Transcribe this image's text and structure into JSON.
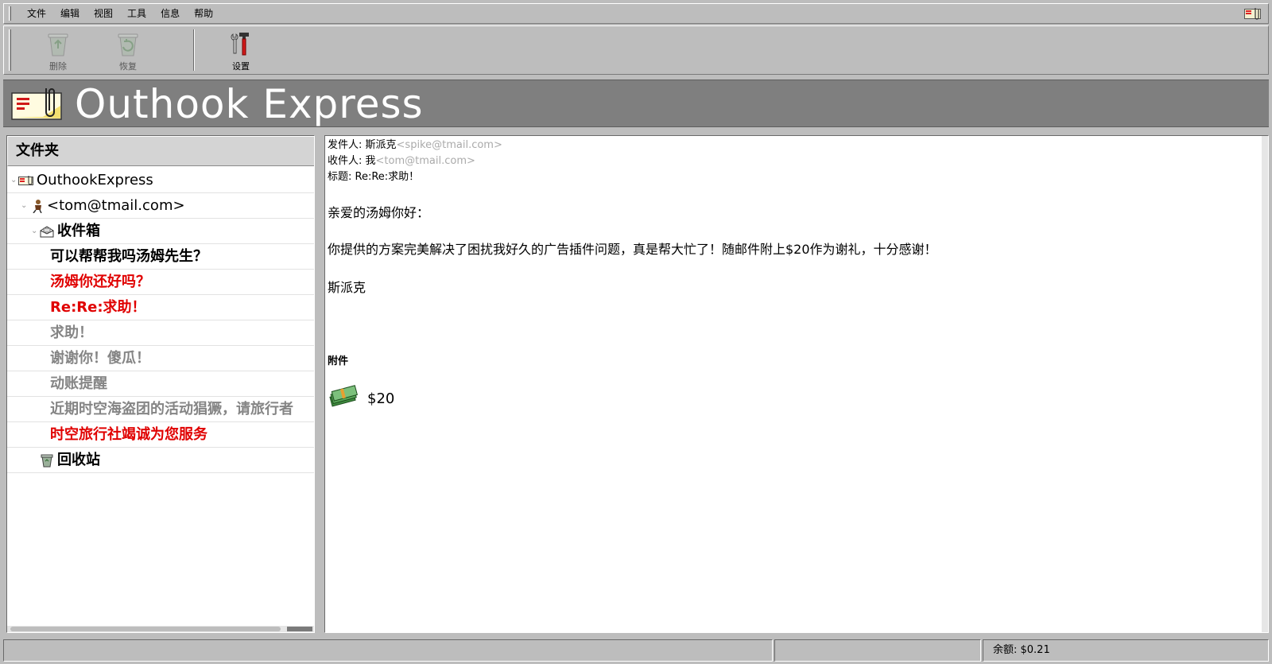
{
  "menubar": {
    "items": [
      "文件",
      "编辑",
      "视图",
      "工具",
      "信息",
      "帮助"
    ]
  },
  "toolbar": {
    "delete_label": "删除",
    "restore_label": "恢复",
    "settings_label": "设置"
  },
  "banner": {
    "title": "Outhook Express"
  },
  "folders": {
    "header": "文件夹",
    "root": "OuthookExpress",
    "account": "<tom@tmail.com>",
    "inbox": "收件箱",
    "messages": [
      {
        "subject": "可以帮帮我吗汤姆先生？",
        "state": "unread"
      },
      {
        "subject": "汤姆你还好吗？",
        "state": "unread-red"
      },
      {
        "subject": "Re:Re:求助！",
        "state": "unread-red"
      },
      {
        "subject": "求助！",
        "state": "read"
      },
      {
        "subject": "谢谢你！傻瓜！",
        "state": "read"
      },
      {
        "subject": "动账提醒",
        "state": "read"
      },
      {
        "subject": "近期时空海盗团的活动猖獗，请旅行者",
        "state": "read"
      },
      {
        "subject": "时空旅行社竭诚为您服务",
        "state": "unread-red"
      }
    ],
    "trash": "回收站"
  },
  "message": {
    "from_label": "发件人: ",
    "from_name": "斯派克",
    "from_addr": "<spike@tmail.com>",
    "to_label": "收件人: ",
    "to_name": "我",
    "to_addr": "<tom@tmail.com>",
    "subject_label": "标题: ",
    "subject": "Re:Re:求助！",
    "greeting": "亲爱的汤姆你好：",
    "body": "你提供的方案完美解决了困扰我好久的广告插件问题，真是帮大忙了！随邮件附上$20作为谢礼，十分感谢！",
    "signature": "斯派克",
    "attachments_label": "附件",
    "attachment_name": "$20"
  },
  "status": {
    "cell1": "",
    "cell2": "",
    "balance": "余额: $0.21"
  },
  "colors": {
    "unread_red": "#e00000",
    "read_gray": "#858585",
    "banner_bg": "#7f7f7f",
    "chrome_bg": "#bdbdbd"
  }
}
